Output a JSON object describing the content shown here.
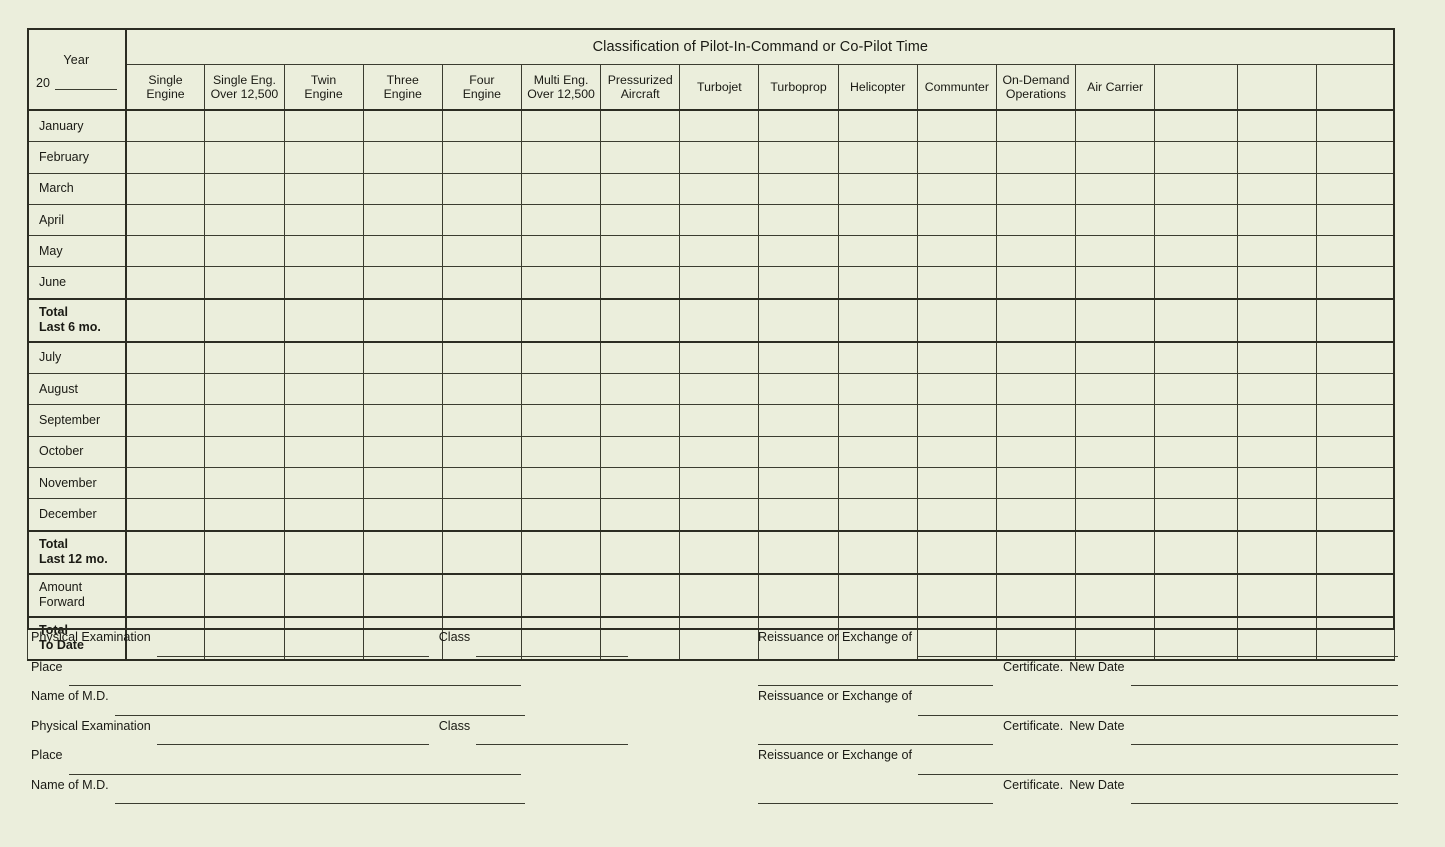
{
  "table": {
    "banner_title": "Classification of Pilot-In-Command or Co-Pilot Time",
    "year_label": "Year",
    "year_prefix": "20",
    "columns": [
      {
        "line1": "Single",
        "line2": "Engine"
      },
      {
        "line1": "Single Eng.",
        "line2": "Over 12,500"
      },
      {
        "line1": "Twin",
        "line2": "Engine"
      },
      {
        "line1": "Three",
        "line2": "Engine"
      },
      {
        "line1": "Four",
        "line2": "Engine"
      },
      {
        "line1": "Multi Eng.",
        "line2": "Over 12,500"
      },
      {
        "line1": "Pressurized",
        "line2": "Aircraft"
      },
      {
        "line1": "Turbojet",
        "line2": ""
      },
      {
        "line1": "Turboprop",
        "line2": ""
      },
      {
        "line1": "Helicopter",
        "line2": ""
      },
      {
        "line1": "Communter",
        "line2": ""
      },
      {
        "line1": "On-Demand",
        "line2": "Operations"
      },
      {
        "line1": "Air Carrier",
        "line2": ""
      },
      {
        "line1": "",
        "line2": ""
      },
      {
        "line1": "",
        "line2": ""
      },
      {
        "line1": "",
        "line2": ""
      }
    ],
    "rows": [
      {
        "line1": "January",
        "line2": "",
        "bold": false,
        "emphasis": false
      },
      {
        "line1": "February",
        "line2": "",
        "bold": false,
        "emphasis": false
      },
      {
        "line1": "March",
        "line2": "",
        "bold": false,
        "emphasis": false
      },
      {
        "line1": "April",
        "line2": "",
        "bold": false,
        "emphasis": false
      },
      {
        "line1": "May",
        "line2": "",
        "bold": false,
        "emphasis": false
      },
      {
        "line1": "June",
        "line2": "",
        "bold": false,
        "emphasis": false
      },
      {
        "line1": "Total",
        "line2": "Last 6 mo.",
        "bold": true,
        "emphasis": true
      },
      {
        "line1": "July",
        "line2": "",
        "bold": false,
        "emphasis": false
      },
      {
        "line1": "August",
        "line2": "",
        "bold": false,
        "emphasis": false
      },
      {
        "line1": "September",
        "line2": "",
        "bold": false,
        "emphasis": false
      },
      {
        "line1": "October",
        "line2": "",
        "bold": false,
        "emphasis": false
      },
      {
        "line1": "November",
        "line2": "",
        "bold": false,
        "emphasis": false
      },
      {
        "line1": "December",
        "line2": "",
        "bold": false,
        "emphasis": false
      },
      {
        "line1": "Total",
        "line2": "Last 12 mo.",
        "bold": true,
        "emphasis": true
      },
      {
        "line1": "Amount",
        "line2": "Forward",
        "bold": false,
        "emphasis": false
      },
      {
        "line1": "Total",
        "line2": "To Date",
        "bold": true,
        "emphasis": true
      }
    ]
  },
  "form": {
    "left_blocks": [
      {
        "exam_label": "Physical Examination",
        "class_label": "Class",
        "place_label": "Place",
        "md_label": "Name of M.D."
      },
      {
        "exam_label": "Physical Examination",
        "class_label": "Class",
        "place_label": "Place",
        "md_label": "Name of M.D."
      }
    ],
    "right_blocks": [
      {
        "reissuance_label": "Reissuance or Exchange of",
        "certificate_label": "Certificate.",
        "newdate_label": "New Date"
      },
      {
        "reissuance_label": "Reissuance or Exchange of",
        "certificate_label": "Certificate.",
        "newdate_label": "New Date"
      },
      {
        "reissuance_label": "Reissuance or Exchange of",
        "certificate_label": "Certificate.",
        "newdate_label": "New Date"
      }
    ]
  },
  "colors": {
    "paper": "#ebeedc",
    "ink": "#1a1a14",
    "rule": "#3b3c30",
    "heavy_rule": "#2b2c22"
  }
}
